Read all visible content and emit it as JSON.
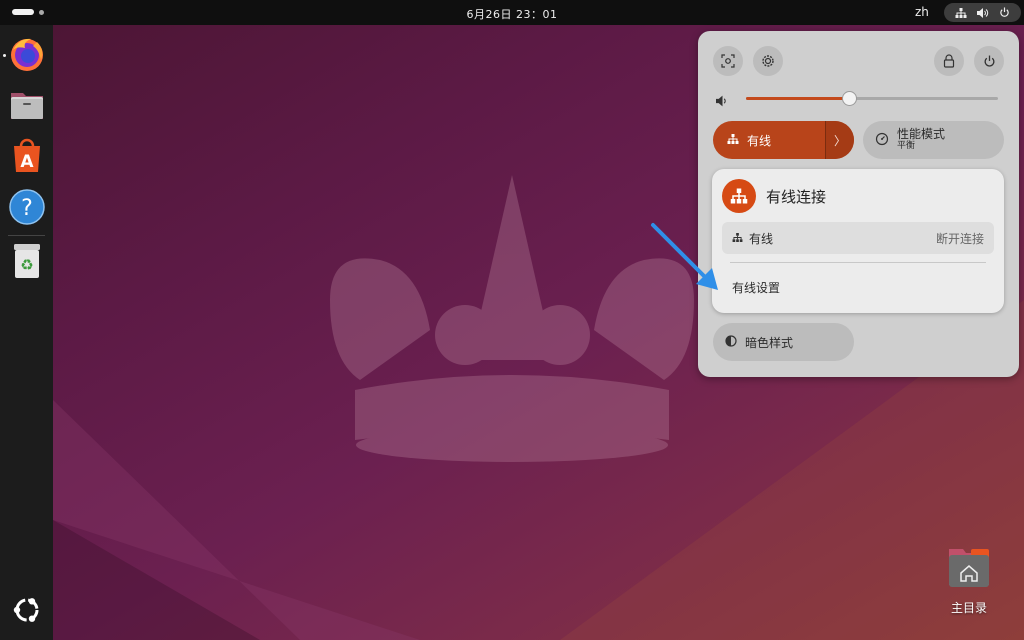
{
  "topbar": {
    "clock": "6月26日  23：01",
    "language": "zh"
  },
  "dock": {
    "items": [
      {
        "name": "firefox",
        "icon": "firefox-icon"
      },
      {
        "name": "files",
        "icon": "files-icon"
      },
      {
        "name": "app-center",
        "icon": "app-store-icon"
      },
      {
        "name": "help",
        "icon": "help-icon"
      },
      {
        "name": "trash",
        "icon": "trash-icon"
      }
    ],
    "apps_button_icon": "ubuntu-logo-icon"
  },
  "quick_settings": {
    "volume_fraction": 0.41,
    "wired_tile": {
      "label": "有线"
    },
    "performance_tile": {
      "label": "性能模式",
      "sublabel": "平衡"
    },
    "wired_menu": {
      "title": "有线连接",
      "connection": {
        "name": "有线",
        "action": "断开连接"
      },
      "settings_label": "有线设置"
    },
    "dark_style_tile": {
      "label": "暗色样式"
    }
  },
  "desktop": {
    "home_folder_label": "主目录"
  },
  "colors": {
    "accent": "#d64a14",
    "tile_active": "#b8441a",
    "annotation_arrow": "#2f8fe8"
  }
}
